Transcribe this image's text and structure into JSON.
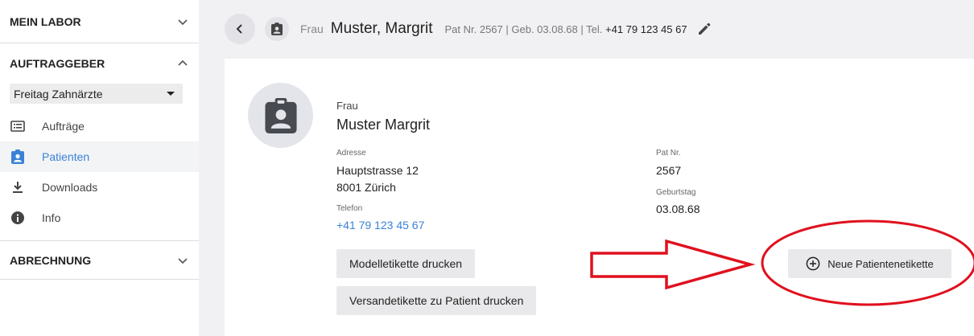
{
  "sidebar": {
    "sections": {
      "mein_labor": "MEIN LABOR",
      "auftraggeber": "AUFTRAGGEBER",
      "abrechnung": "ABRECHNUNG"
    },
    "client_select": "Freitag Zahnärzte",
    "items": [
      {
        "label": "Aufträge",
        "icon": "list-icon"
      },
      {
        "label": "Patienten",
        "icon": "patient-badge-icon",
        "active": true
      },
      {
        "label": "Downloads",
        "icon": "download-icon"
      },
      {
        "label": "Info",
        "icon": "info-icon"
      }
    ]
  },
  "header": {
    "salutation": "Frau",
    "name": "Muster, Margrit",
    "meta": "Pat Nr. 2567 | Geb. 03.08.68 | Tel.",
    "tel": "+41 79 123 45 67"
  },
  "patient": {
    "salutation": "Frau",
    "name": "Muster Margrit",
    "address_label": "Adresse",
    "address_line1": "Hauptstrasse 12",
    "address_line2": "8001 Zürich",
    "phone_label": "Telefon",
    "phone": "+41 79 123 45 67",
    "patnr_label": "Pat Nr.",
    "patnr": "2567",
    "birthday_label": "Geburtstag",
    "birthday": "03.08.68"
  },
  "actions": {
    "model_label": "Modelletikette drucken",
    "shipping_label": "Versandetikette zu Patient drucken",
    "new_label": "Neue Patientenetikette"
  },
  "colors": {
    "accent": "#3b82d6",
    "annotation": "#e0101e"
  }
}
